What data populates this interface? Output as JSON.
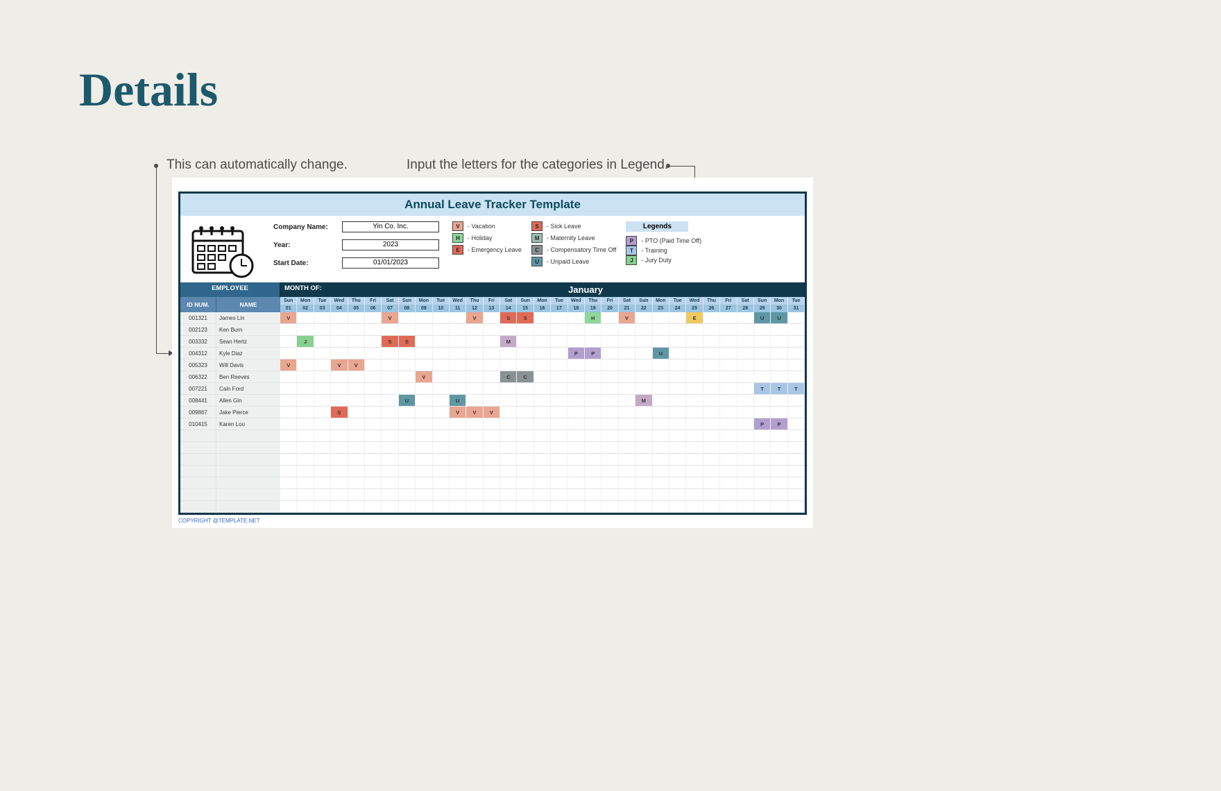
{
  "page_title": "Details",
  "callouts": {
    "left": "This can automatically change.",
    "right": "Input the letters for the categories in Legend."
  },
  "tracker": {
    "title": "Annual Leave Tracker Template",
    "fields": {
      "company_label": "Company Name:",
      "company_value": "Yin Co. Inc.",
      "year_label": "Year:",
      "year_value": "2023",
      "start_label": "Start Date:",
      "start_value": "01/01/2023"
    },
    "legend_title": "Legends",
    "legends": {
      "col1": [
        {
          "code": "V",
          "label": "- Vacation"
        },
        {
          "code": "H",
          "label": "- Holiday"
        },
        {
          "code": "E",
          "label": "- Emergency Leave"
        }
      ],
      "col2": [
        {
          "code": "S",
          "label": "- Sick Leave"
        },
        {
          "code": "M",
          "label": "- Maternity Leave"
        },
        {
          "code": "C",
          "label": "- Compensatory Time Off"
        },
        {
          "code": "U",
          "label": "- Unpaid Leave"
        }
      ],
      "col3": [
        {
          "code": "P",
          "label": "- PTO (Paid Time Off)"
        },
        {
          "code": "T",
          "label": "- Training"
        },
        {
          "code": "J",
          "label": "- Jury Duty"
        }
      ]
    },
    "headers": {
      "employee": "EMPLOYEE",
      "month_of": "MONTH OF:",
      "month_name": "January",
      "id": "ID NUM.",
      "name": "NAME"
    },
    "day_names": [
      "Sun",
      "Mon",
      "Tue",
      "Wed",
      "Thu",
      "Fri",
      "Sat",
      "Sun",
      "Mon",
      "Tue",
      "Wed",
      "Thu",
      "Fri",
      "Sat",
      "Sun",
      "Mon",
      "Tue",
      "Wed",
      "Thu",
      "Fri",
      "Sat",
      "Sun",
      "Mon",
      "Tue",
      "Wed",
      "Thu",
      "Fri",
      "Sat",
      "Sun",
      "Mon",
      "Tue"
    ],
    "day_nums": [
      "01",
      "02",
      "03",
      "04",
      "05",
      "06",
      "07",
      "08",
      "09",
      "10",
      "11",
      "12",
      "13",
      "14",
      "15",
      "16",
      "17",
      "18",
      "19",
      "20",
      "21",
      "22",
      "23",
      "24",
      "25",
      "26",
      "27",
      "28",
      "29",
      "30",
      "31"
    ],
    "rows": [
      {
        "id": "001321",
        "name": "James Lin",
        "cells": {
          "1": "V",
          "7": "V",
          "12": "V",
          "14": "S",
          "15": "S",
          "19": "H",
          "21": "V",
          "25": "E",
          "29": "U",
          "30": "U"
        }
      },
      {
        "id": "002123",
        "name": "Ken Burn",
        "cells": {}
      },
      {
        "id": "003332",
        "name": "Sean Hertz",
        "cells": {
          "2": "J",
          "7": "S",
          "8": "S",
          "14": "M"
        }
      },
      {
        "id": "004312",
        "name": "Kyle Diaz",
        "cells": {
          "18": "P",
          "19": "P",
          "23": "U"
        }
      },
      {
        "id": "005323",
        "name": "Will Davis",
        "cells": {
          "1": "V",
          "4": "V",
          "5": "V"
        }
      },
      {
        "id": "006322",
        "name": "Ben Reeves",
        "cells": {
          "9": "V",
          "14": "C",
          "15": "C"
        }
      },
      {
        "id": "007221",
        "name": "Cain Ford",
        "cells": {
          "29": "T",
          "30": "T",
          "31": "T"
        }
      },
      {
        "id": "008441",
        "name": "Allen Gin",
        "cells": {
          "8": "U",
          "11": "U",
          "22": "M"
        }
      },
      {
        "id": "009867",
        "name": "Jake Pierce",
        "cells": {
          "4": "S",
          "11": "V",
          "12": "V",
          "13": "V"
        }
      },
      {
        "id": "010415",
        "name": "Karen Lou",
        "cells": {
          "29": "P",
          "30": "P"
        }
      }
    ],
    "empty_rows": 7,
    "copyright": "COPYRIGHT @TEMPLATE.NET"
  },
  "colors": {
    "V": "#e9a690",
    "H": "#8ed69a",
    "E": "#f0c95e",
    "S": "#e06a57",
    "M": "#c4a9c6",
    "C": "#8a9193",
    "U": "#5e97a3",
    "P": "#b29ecf",
    "T": "#a7c6e6",
    "J": "#88d08f"
  }
}
